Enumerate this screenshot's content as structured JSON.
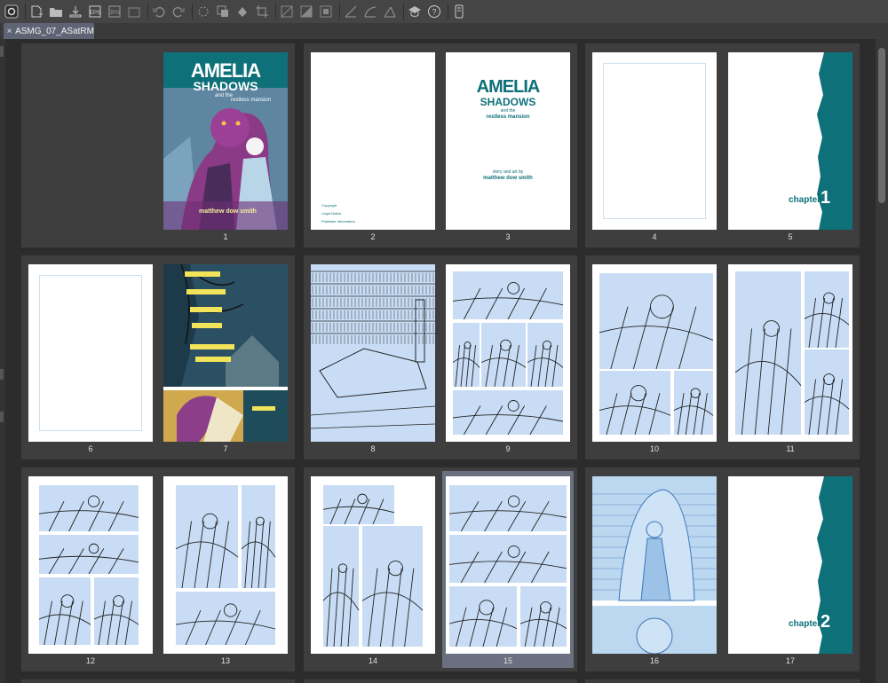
{
  "toolbar": {
    "buttons": [
      {
        "name": "app-logo-icon",
        "interact": true
      },
      {
        "sep": true
      },
      {
        "name": "new-document-icon",
        "interact": true
      },
      {
        "name": "open-folder-icon",
        "interact": true
      },
      {
        "name": "save-icon",
        "interact": true
      },
      {
        "name": "export-eps-icon",
        "interact": true
      },
      {
        "name": "export-ipg-icon",
        "interact": true
      },
      {
        "name": "import-icon",
        "interact": true
      },
      {
        "sep": true
      },
      {
        "name": "undo-icon",
        "interact": true
      },
      {
        "name": "redo-icon",
        "interact": true
      },
      {
        "sep": true
      },
      {
        "name": "loading-icon",
        "interact": true
      },
      {
        "name": "transform-icon",
        "interact": true
      },
      {
        "name": "fill-icon",
        "interact": true
      },
      {
        "name": "crop-icon",
        "interact": true
      },
      {
        "sep": true
      },
      {
        "name": "perspective-icon",
        "interact": true
      },
      {
        "name": "contrast-icon",
        "interact": true
      },
      {
        "name": "expand-icon",
        "interact": true
      },
      {
        "sep": true
      },
      {
        "name": "ruler-icon",
        "interact": true
      },
      {
        "name": "curve-ruler-icon",
        "interact": true
      },
      {
        "name": "symmetry-ruler-icon",
        "interact": true
      },
      {
        "sep": true
      },
      {
        "name": "learn-icon",
        "interact": true
      },
      {
        "name": "help-icon",
        "interact": true
      },
      {
        "sep": true
      },
      {
        "name": "device-icon",
        "interact": true
      }
    ]
  },
  "tab": {
    "close_symbol": "×",
    "title": "ASMG_07_ASatRM"
  },
  "cover": {
    "title1": "AMELIA",
    "title2": "SHADOWS",
    "subtitle1": "and the",
    "subtitle2": "restless mansion",
    "author": "matthew dow smith"
  },
  "title_page": {
    "title1": "AMELIA",
    "title2": "SHADOWS",
    "subtitle1": "and the",
    "subtitle2": "restless mansion",
    "credit_line": "story and art by",
    "author": "matthew dow smith"
  },
  "copyright_lines": [
    "Copyright",
    "Legal Notice",
    "Publisher Information"
  ],
  "chapters": [
    {
      "word": "chapter",
      "num": "1"
    },
    {
      "word": "chapter",
      "num": "2"
    }
  ],
  "pages": [
    "1",
    "2",
    "3",
    "4",
    "5",
    "6",
    "7",
    "8",
    "9",
    "10",
    "11",
    "12",
    "13",
    "14",
    "15",
    "16",
    "17"
  ],
  "selected_page": "15",
  "colors": {
    "teal": "#0e7079",
    "selected_spread": "#6a7080",
    "pencil_blue": "#c8ddf5",
    "caption_yellow": "#f1e35a"
  }
}
